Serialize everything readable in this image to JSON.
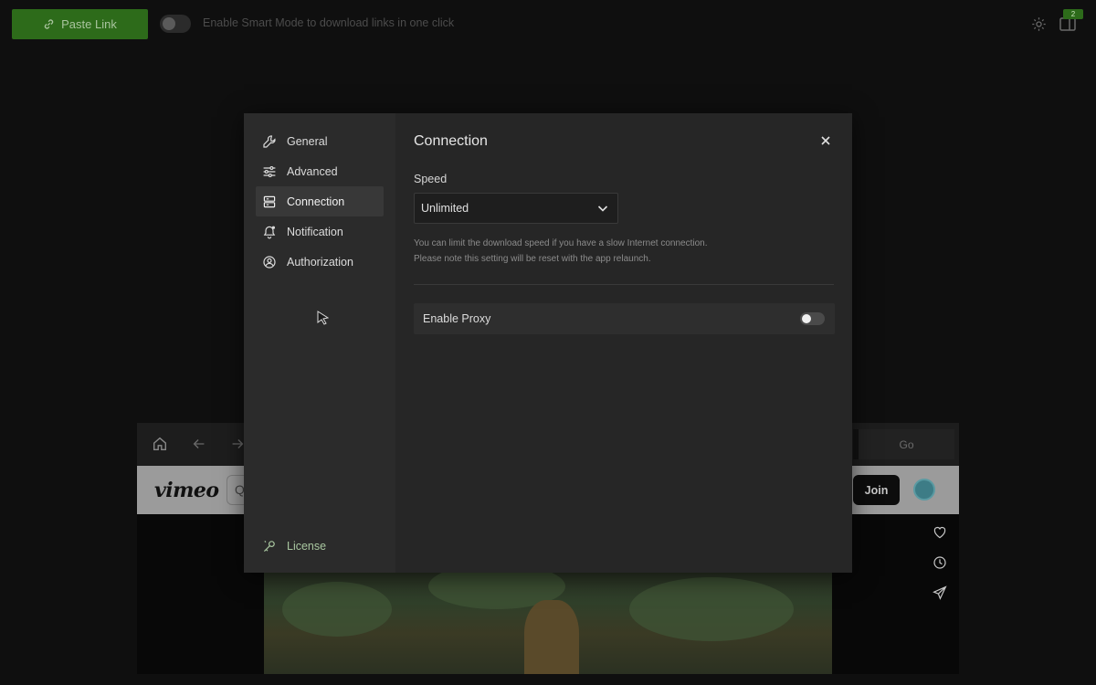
{
  "topbar": {
    "paste_label": "Paste Link",
    "smart_mode_text": "Enable Smart Mode to download links in one click",
    "badge_count": "2",
    "accent": "#2d6b1a"
  },
  "browser": {
    "go_label": "Go",
    "vimeo_logo": "vimeo",
    "search_glyph": "Q",
    "join_label": "Join"
  },
  "settings": {
    "nav": [
      {
        "label": "General",
        "icon": "wrench-icon"
      },
      {
        "label": "Advanced",
        "icon": "sliders-icon"
      },
      {
        "label": "Connection",
        "icon": "server-icon"
      },
      {
        "label": "Notification",
        "icon": "bell-icon"
      },
      {
        "label": "Authorization",
        "icon": "user-circle-icon"
      }
    ],
    "active_item": "Connection",
    "license_label": "License",
    "title": "Connection",
    "speed_label": "Speed",
    "speed_value": "Unlimited",
    "hint_line1": "You can limit the download speed if you have a slow Internet connection.",
    "hint_line2": "Please note this setting will be reset with the app relaunch.",
    "proxy_label": "Enable Proxy",
    "proxy_enabled": false
  }
}
